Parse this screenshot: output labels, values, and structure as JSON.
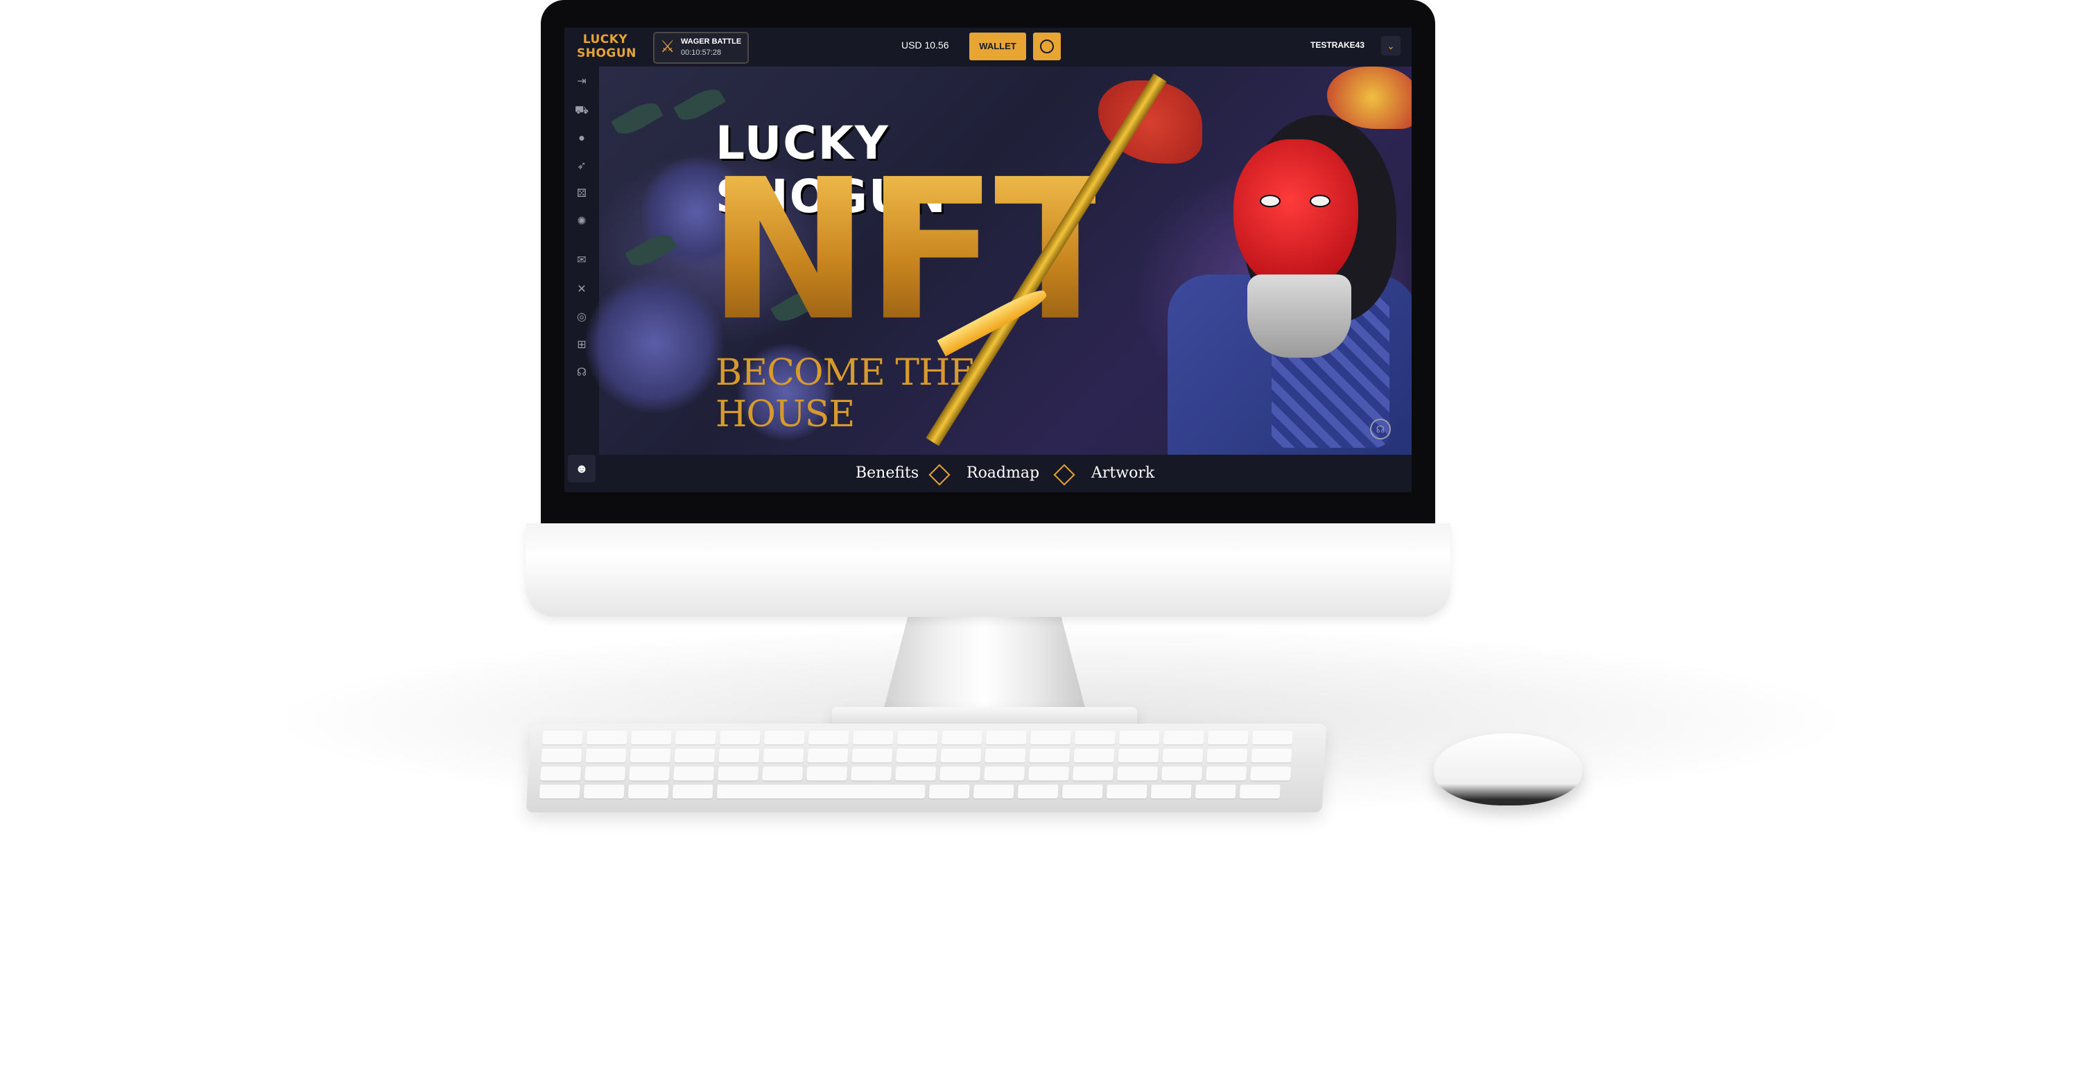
{
  "header": {
    "logo_text": "LUCKY SHOGUN",
    "wager_title": "WAGER BATTLE",
    "wager_timer": "00:10:57:28",
    "balance": "USD 10.56",
    "wallet_label": "WALLET",
    "username": "TESTRAKE43"
  },
  "hero": {
    "title": "LUCKY SHOGUN",
    "headline": "NFT",
    "subtitle": "BECOME THE HOUSE"
  },
  "nav": {
    "items": [
      "Benefits",
      "Roadmap",
      "Artwork"
    ]
  },
  "sidebar": {
    "icons": [
      "collapse-icon",
      "cart-icon",
      "user-icon",
      "rocket-icon",
      "dice-icon",
      "roulette-icon",
      "gift-icon",
      "crossed-swords-icon",
      "coin-icon",
      "grid-icon",
      "headset-icon"
    ]
  },
  "colors": {
    "accent": "#e8a534",
    "topbar_bg": "#171826",
    "hero_bg": "#1f2038"
  }
}
